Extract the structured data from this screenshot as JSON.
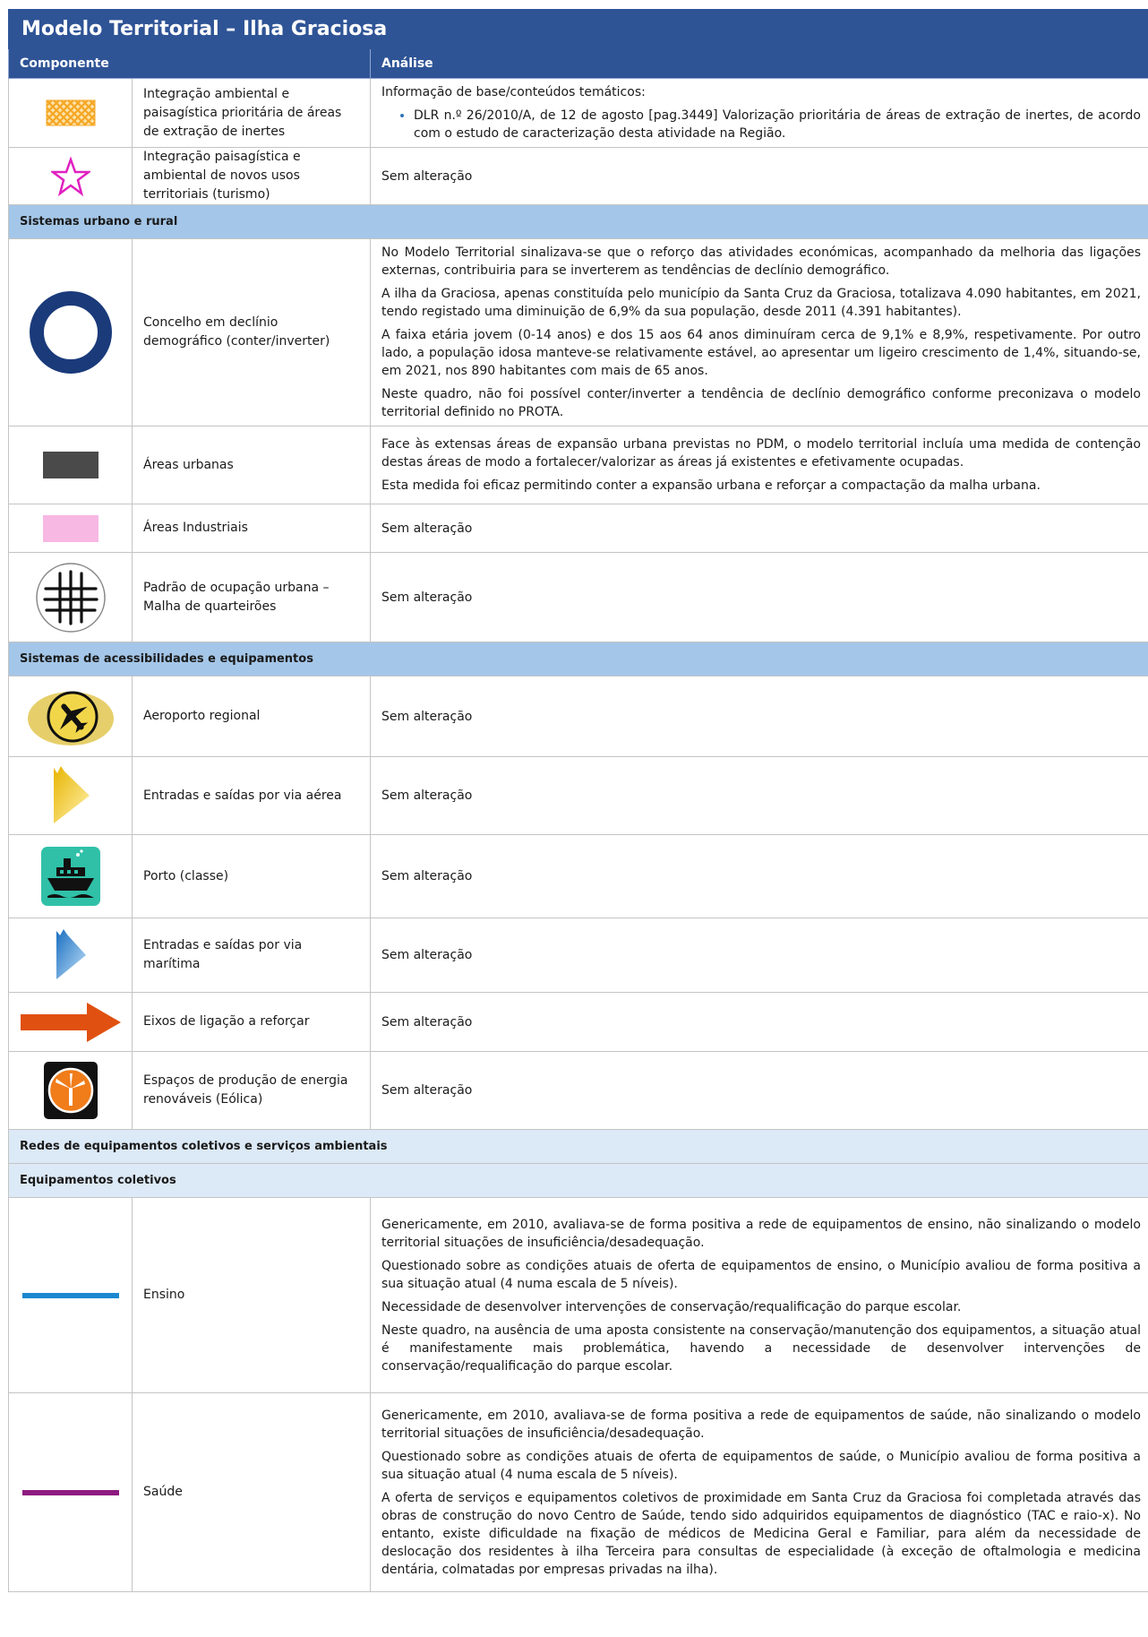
{
  "title": "Modelo Territorial – Ilha Graciosa",
  "header": {
    "col_component": "Componente",
    "col_analysis": "Análise"
  },
  "rows": {
    "extracao": {
      "label": "Integração ambiental e paisagística prioritária de áreas de extração de inertes",
      "intro": "Informação de base/conteúdos temáticos:",
      "bullet": "DLR n.º 26/2010/A, de 12 de agosto [pag.3449] Valorização prioritária de áreas de extração de inertes, de acordo com o estudo de caracterização desta atividade na Região."
    },
    "turismo": {
      "label": "Integração paisagística e ambiental de novos usos territoriais (turismo)",
      "analysis": "Sem alteração"
    },
    "declinio": {
      "label": "Concelho em declínio demográfico (conter/inverter)",
      "p1": "No Modelo Territorial sinalizava-se que o reforço das atividades económicas, acompanhado da melhoria das ligações externas, contribuiria para se inverterem as tendências de declínio demográfico.",
      "p2": "A ilha da Graciosa, apenas constituída pelo município da Santa Cruz da Graciosa, totalizava 4.090 habitantes, em 2021, tendo registado uma diminuição de 6,9% da sua população, desde 2011 (4.391 habitantes).",
      "p3": "A faixa etária jovem (0-14 anos) e dos 15 aos 64 anos diminuíram cerca de 9,1% e 8,9%, respetivamente. Por outro lado, a população idosa manteve-se relativamente estável, ao apresentar um ligeiro crescimento de 1,4%, situando-se, em 2021, nos 890 habitantes com mais de 65 anos.",
      "p4": "Neste quadro, não foi possível conter/inverter a tendência de declínio demográfico conforme preconizava o modelo territorial definido no PROTA."
    },
    "urbanas": {
      "label": "Áreas urbanas",
      "p1": "Face às extensas áreas de expansão urbana previstas no PDM, o modelo territorial incluía uma medida de contenção destas áreas de modo a fortalecer/valorizar as áreas já existentes e efetivamente ocupadas.",
      "p2": "Esta medida foi eficaz permitindo conter a expansão urbana e reforçar a compactação da malha urbana."
    },
    "industriais": {
      "label": "Áreas Industriais",
      "analysis": "Sem alteração"
    },
    "malha": {
      "label": "Padrão de ocupação urbana – Malha de quarteirões",
      "analysis": "Sem alteração"
    },
    "aeroporto": {
      "label": "Aeroporto regional",
      "analysis": "Sem alteração"
    },
    "aerea": {
      "label": "Entradas e saídas por via aérea",
      "analysis": "Sem alteração"
    },
    "porto": {
      "label": "Porto (classe)",
      "analysis": "Sem alteração"
    },
    "maritima": {
      "label": "Entradas e saídas por via marítima",
      "analysis": "Sem alteração"
    },
    "eixos": {
      "label": "Eixos de ligação a reforçar",
      "analysis": "Sem alteração"
    },
    "eolica": {
      "label": "Espaços de produção de energia renováveis (Eólica)",
      "analysis": "Sem alteração"
    },
    "ensino": {
      "label": "Ensino",
      "p1": "Genericamente, em 2010, avaliava-se de forma positiva a rede de equipamentos de ensino, não sinalizando o modelo territorial situações de insuficiência/desadequação.",
      "p2": "Questionado sobre as condições atuais de oferta de equipamentos de ensino, o Município avaliou de forma positiva a sua situação atual (4 numa escala de 5 níveis).",
      "p3": "Necessidade de desenvolver intervenções de conservação/requalificação do parque escolar.",
      "p4": "Neste quadro, na ausência de uma aposta consistente na conservação/manutenção dos equipamentos, a situação atual é manifestamente mais problemática, havendo a necessidade de desenvolver intervenções de conservação/requalificação do parque escolar."
    },
    "saude": {
      "label": "Saúde",
      "p1": "Genericamente, em 2010, avaliava-se de forma positiva a rede de equipamentos de saúde, não sinalizando o modelo territorial situações de insuficiência/desadequação.",
      "p2": "Questionado sobre as condições atuais de oferta de equipamentos de saúde, o Município avaliou de forma positiva a sua situação atual (4 numa escala de 5 níveis).",
      "p3": "A oferta de serviços e equipamentos coletivos de proximidade em Santa Cruz da Graciosa foi completada através das obras de construção do novo Centro de Saúde, tendo sido adquiridos equipamentos de diagnóstico (TAC e raio-x). No entanto, existe dificuldade na fixação de médicos de Medicina Geral e Familiar, para além da necessidade de deslocação dos residentes à ilha Terceira para consultas de especialidade (à exceção de oftalmologia e medicina dentária, colmatadas por empresas privadas na ilha)."
    }
  },
  "sections": {
    "urbano": "Sistemas urbano e rural",
    "acessibilidades": "Sistemas de acessibilidades e equipamentos",
    "redes": "Redes de equipamentos coletivos e serviços ambientais",
    "equipamentos": "Equipamentos coletivos"
  },
  "colors": {
    "header_bg": "#2f5496",
    "section_blue": "#a4c6e8",
    "section_light": "#dce9f6",
    "extraction": "#f5a623",
    "star": "#e020c0",
    "ring": "#1a3a7a",
    "urban": "#4a4a4a",
    "industrial": "#f7b8e4",
    "arrow": "#e05010",
    "ensino": "#1a88d0",
    "saude": "#8e1a80"
  },
  "icons": {
    "extracao": "crosshatch-pattern-icon",
    "turismo": "star-outline-icon",
    "declinio": "ring-icon",
    "urbanas": "gray-rectangle-icon",
    "industriais": "pink-rectangle-icon",
    "malha": "street-grid-icon",
    "aeroporto": "airplane-icon",
    "aerea": "yellow-chevron-icon",
    "porto": "ship-icon",
    "maritima": "blue-chevron-icon",
    "eixos": "orange-arrow-icon",
    "eolica": "wind-turbine-icon",
    "ensino": "blue-line-icon",
    "saude": "purple-line-icon"
  }
}
